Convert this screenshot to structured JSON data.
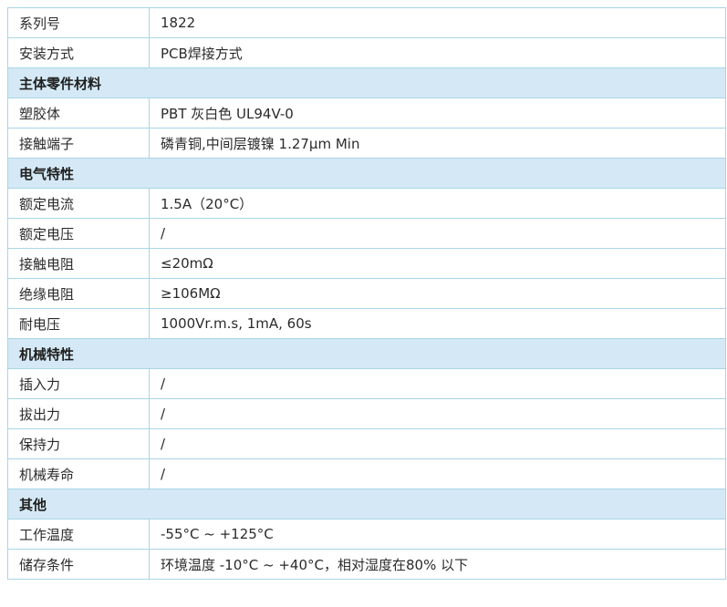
{
  "table": {
    "rows": [
      {
        "type": "data",
        "label": "系列号",
        "value": "1822"
      },
      {
        "type": "data",
        "label": "安装方式",
        "value": "PCB焊接方式"
      },
      {
        "type": "section",
        "label": "主体零件材料"
      },
      {
        "type": "data",
        "label": "塑胶体",
        "value": "PBT 灰白色 UL94V-0"
      },
      {
        "type": "data",
        "label": "接触端子",
        "value": "磷青铜,中间层镀镍 1.27μm Min"
      },
      {
        "type": "section",
        "label": "电气特性"
      },
      {
        "type": "data",
        "label": "额定电流",
        "value": "1.5A（20°C）"
      },
      {
        "type": "data",
        "label": "额定电压",
        "value": "/"
      },
      {
        "type": "data",
        "label": "接触电阻",
        "value": "≤20mΩ"
      },
      {
        "type": "data",
        "label": "绝缘电阻",
        "value": "≥106MΩ"
      },
      {
        "type": "data",
        "label": "耐电压",
        "value": "1000Vr.m.s, 1mA, 60s"
      },
      {
        "type": "section",
        "label": "机械特性"
      },
      {
        "type": "data",
        "label": "插入力",
        "value": "/"
      },
      {
        "type": "data",
        "label": "拔出力",
        "value": "/"
      },
      {
        "type": "data",
        "label": "保持力",
        "value": "/"
      },
      {
        "type": "data",
        "label": "机械寿命",
        "value": "/"
      },
      {
        "type": "section",
        "label": "其他"
      },
      {
        "type": "data",
        "label": "工作温度",
        "value": "-55°C ~ +125°C"
      },
      {
        "type": "data",
        "label": "储存条件",
        "value": "环境温度 -10°C ~ +40°C，相对湿度在80% 以下"
      }
    ]
  }
}
